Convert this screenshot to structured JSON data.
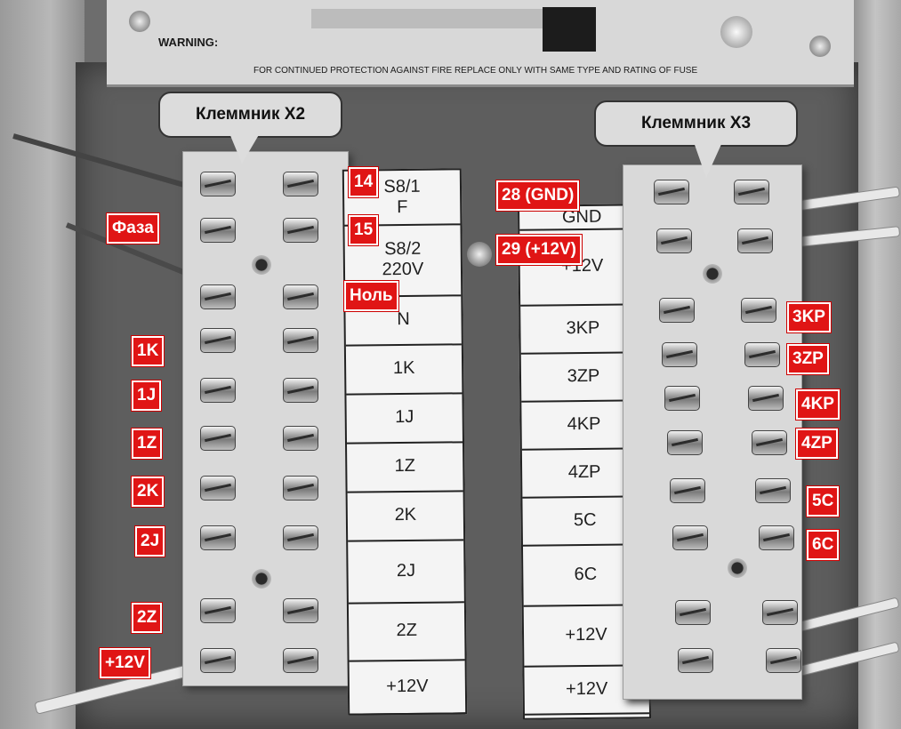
{
  "pcb": {
    "warning": "WARNING:",
    "fuse_notice": "FOR CONTINUED PROTECTION AGAINST FIRE REPLACE ONLY WITH SAME TYPE AND RATING OF FUSE"
  },
  "callouts": {
    "x2": "Клеммник X2",
    "x3": "Клеммник X3"
  },
  "x2_card": [
    "S8/1\nF",
    "S8/2\n220V",
    "N",
    "1K",
    "1J",
    "1Z",
    "2K",
    "2J",
    "2Z",
    "+12V"
  ],
  "x3_card": [
    "GND",
    "+12V",
    "3KP",
    "3ZP",
    "4KP",
    "4ZP",
    "5C",
    "6C",
    "+12V",
    "+12V"
  ],
  "x2_left_tags": [
    "Фаза",
    "1K",
    "1J",
    "1Z",
    "2K",
    "2J",
    "2Z",
    "+12V"
  ],
  "x2_right_tags": [
    "14",
    "15",
    "Ноль"
  ],
  "x3_left_tags": [
    "28 (GND)",
    "29 (+12V)"
  ],
  "x3_right_tags": [
    "3KP",
    "3ZP",
    "4KP",
    "4ZP",
    "5C",
    "6C"
  ],
  "colors": {
    "tag_red": "#e01515",
    "card_white": "#f4f4f4"
  }
}
